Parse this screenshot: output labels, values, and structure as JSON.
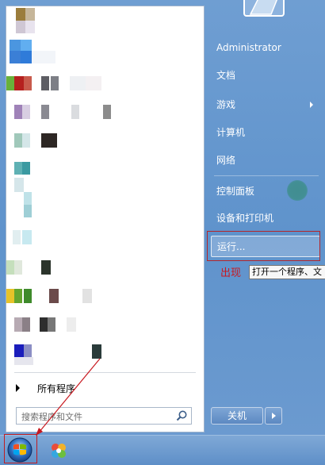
{
  "start_menu": {
    "left_pane": {
      "all_programs_label": "所有程序",
      "search_placeholder": "搜索程序和文件"
    },
    "right_pane": {
      "items": [
        {
          "label": "Administrator"
        },
        {
          "label": "文档"
        },
        {
          "label": "游戏"
        },
        {
          "label": "计算机"
        },
        {
          "label": "网络"
        },
        {
          "label": "控制面板"
        },
        {
          "label": "设备和打印机"
        },
        {
          "label": "运行..."
        }
      ],
      "shutdown_label": "关机"
    }
  },
  "annotation": {
    "text": "出现",
    "tooltip": "打开一个程序、文"
  },
  "icons": {
    "start": "windows-start-orb-icon",
    "search": "search-magnifier-icon",
    "taskbar_app": "colorful-app-icon"
  },
  "colors": {
    "menu_blue": "#6f9ed2",
    "annotation_red": "#c8181f"
  }
}
